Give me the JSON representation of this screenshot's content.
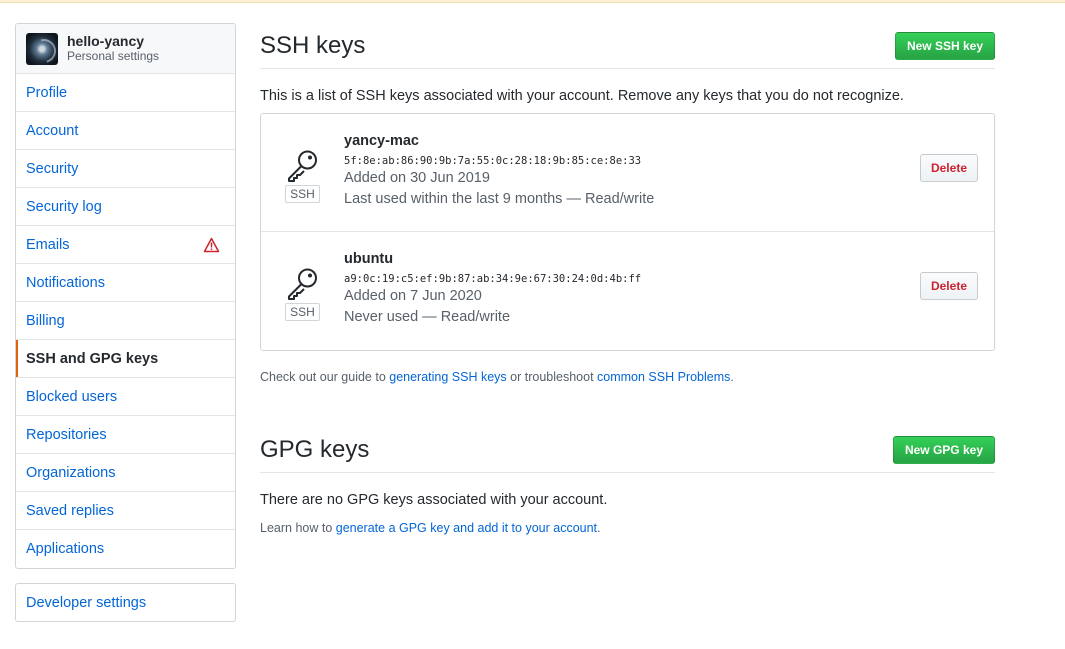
{
  "sidebar": {
    "user": {
      "name": "hello-yancy",
      "subtitle": "Personal settings"
    },
    "items": [
      {
        "label": "Profile"
      },
      {
        "label": "Account"
      },
      {
        "label": "Security"
      },
      {
        "label": "Security log"
      },
      {
        "label": "Emails",
        "icon": "warning-icon"
      },
      {
        "label": "Notifications"
      },
      {
        "label": "Billing"
      },
      {
        "label": "SSH and GPG keys",
        "selected": true
      },
      {
        "label": "Blocked users"
      },
      {
        "label": "Repositories"
      },
      {
        "label": "Organizations"
      },
      {
        "label": "Saved replies"
      },
      {
        "label": "Applications"
      }
    ],
    "developer": "Developer settings"
  },
  "ssh": {
    "title": "SSH keys",
    "new_button": "New SSH key",
    "lead": "This is a list of SSH keys associated with your account. Remove any keys that you do not recognize.",
    "keys": [
      {
        "title": "yancy-mac",
        "fingerprint": "5f:8e:ab:86:90:9b:7a:55:0c:28:18:9b:85:ce:8e:33",
        "added": "Added on 30 Jun 2019",
        "usage": "Last used within the last 9 months — Read/write",
        "badge": "SSH",
        "delete": "Delete"
      },
      {
        "title": "ubuntu",
        "fingerprint": "a9:0c:19:c5:ef:9b:87:ab:34:9e:67:30:24:0d:4b:ff",
        "added": "Added on 7 Jun 2020",
        "usage": "Never used — Read/write",
        "badge": "SSH",
        "delete": "Delete"
      }
    ],
    "note_prefix": "Check out our guide to ",
    "note_link1": "generating SSH keys",
    "note_middle": " or troubleshoot ",
    "note_link2": "common SSH Problems",
    "note_suffix": "."
  },
  "gpg": {
    "title": "GPG keys",
    "new_button": "New GPG key",
    "empty": "There are no GPG keys associated with your account.",
    "note_prefix": "Learn how to ",
    "note_link": "generate a GPG key and add it to your account",
    "note_suffix": "."
  },
  "colors": {
    "link": "#0366d6",
    "green": "#28a745",
    "danger": "#cb2431",
    "selected_bar": "#e36209"
  }
}
